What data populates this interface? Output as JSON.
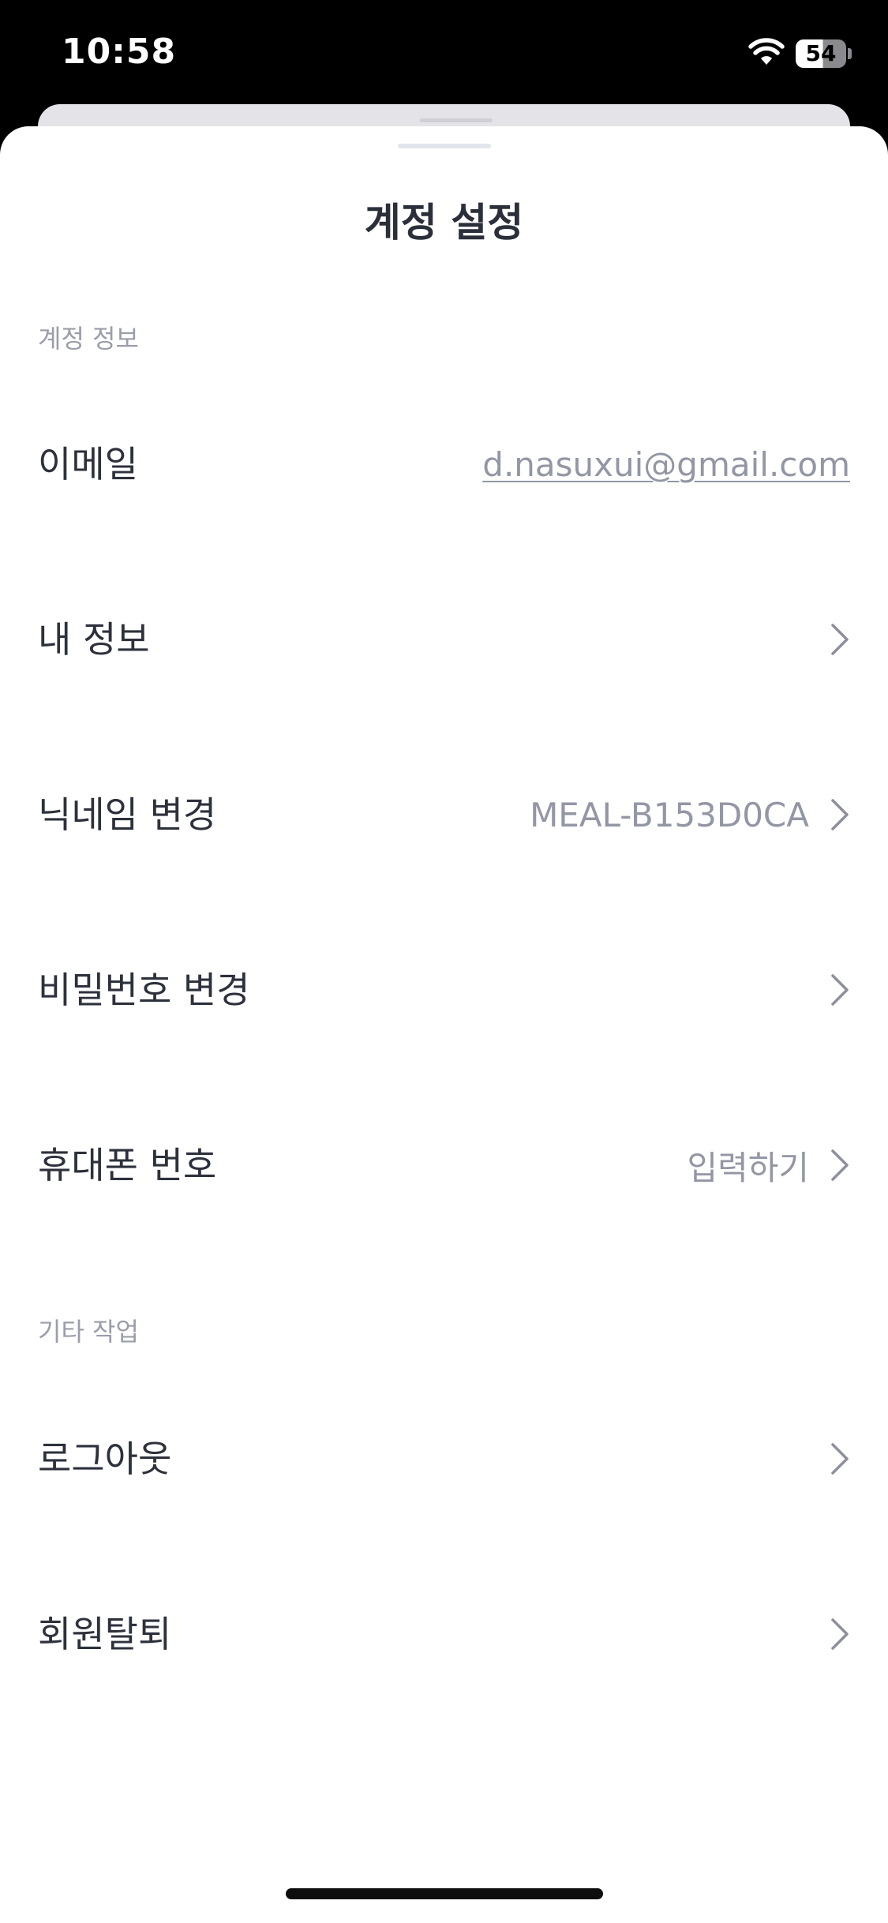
{
  "status_bar": {
    "time": "10:58",
    "battery_level": "54",
    "wifi_icon": "wifi-icon",
    "battery_icon": "battery-icon"
  },
  "sheet": {
    "title": "계정 설정"
  },
  "sections": {
    "account_info": {
      "header": "계정 정보",
      "email": {
        "label": "이메일",
        "value": "d.nasuxui@gmail.com"
      },
      "my_info": {
        "label": "내 정보"
      },
      "nickname": {
        "label": "닉네임 변경",
        "value": "MEAL-B153D0CA"
      },
      "password": {
        "label": "비밀번호 변경"
      },
      "phone": {
        "label": "휴대폰 번호",
        "value": "입력하기"
      }
    },
    "other": {
      "header": "기타 작업",
      "logout": {
        "label": "로그아웃"
      },
      "withdraw": {
        "label": "회원탈퇴"
      }
    }
  },
  "icons": {
    "chevron": "chevron-right-icon"
  },
  "colors": {
    "label": "#2d313c",
    "value": "#9396a4",
    "section_header": "#9a9daa",
    "title": "#2b2f3a",
    "chevron": "#8d909c"
  }
}
